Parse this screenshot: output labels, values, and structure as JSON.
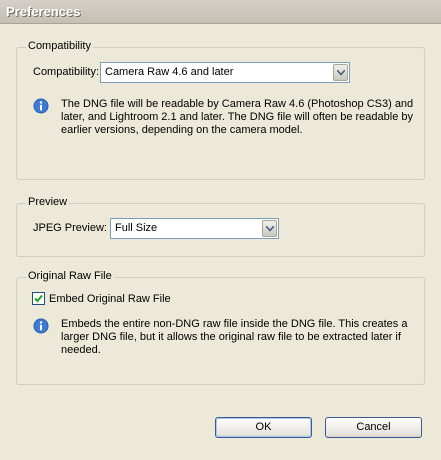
{
  "window": {
    "title": "Preferences"
  },
  "compatibility": {
    "group_label": "Compatibility",
    "field_label": "Compatibility:",
    "selected_value": "Camera Raw 4.6 and later",
    "info_lines": [
      "The DNG file will be readable by Camera Raw 4.6 (Photoshop CS3) and",
      "later, and Lightroom 2.1 and later. The DNG file will often be readable by",
      "earlier versions, depending on the camera model."
    ]
  },
  "preview": {
    "group_label": "Preview",
    "field_label": "JPEG Preview:",
    "selected_value": "Full Size"
  },
  "original_raw": {
    "group_label": "Original Raw File",
    "checkbox_label": "Embed Original Raw File",
    "checkbox_checked": true,
    "info_lines": [
      "Embeds the entire non-DNG raw file inside the DNG file.  This creates a",
      "larger DNG file, but it allows the original raw file to be extracted later if",
      "needed."
    ]
  },
  "buttons": {
    "ok": "OK",
    "cancel": "Cancel"
  },
  "icons": {
    "info": "info-icon",
    "dropdown": "chevron-down-icon",
    "check": "check-icon"
  }
}
